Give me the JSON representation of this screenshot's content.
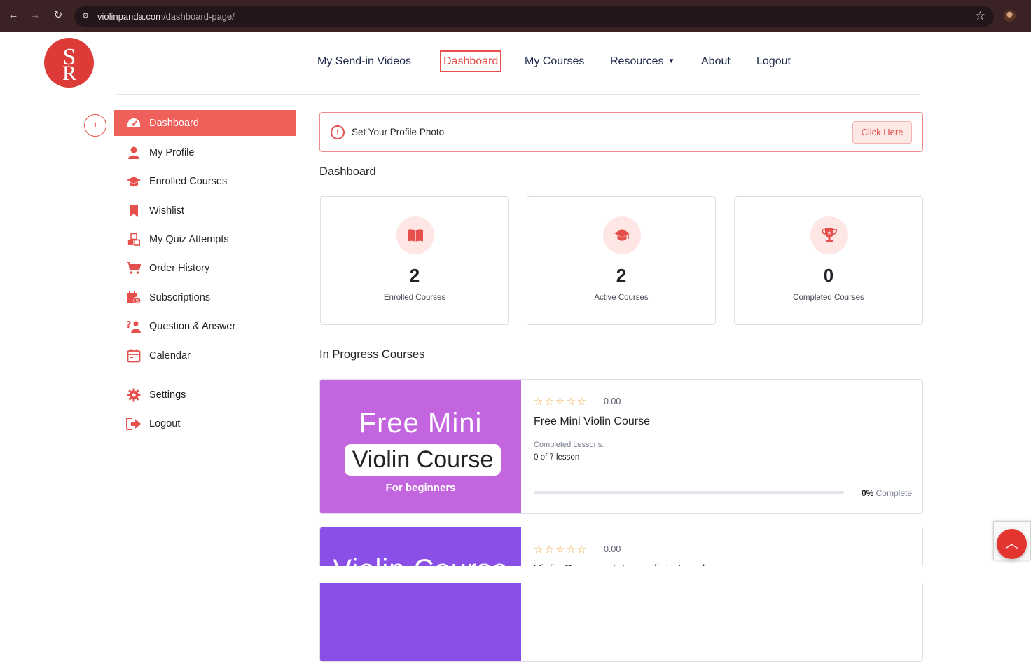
{
  "browser": {
    "url_host": "violinpanda.com",
    "url_path": "/dashboard-page/"
  },
  "topnav": {
    "items": [
      "My Send-in Videos",
      "Dashboard",
      "My Courses",
      "Resources",
      "About",
      "Logout"
    ],
    "active": "Dashboard"
  },
  "sidebar": {
    "step": "1",
    "items": [
      {
        "label": "Dashboard",
        "icon": "dashboard-icon"
      },
      {
        "label": "My Profile",
        "icon": "user-icon"
      },
      {
        "label": "Enrolled Courses",
        "icon": "graduation-cap-icon"
      },
      {
        "label": "Wishlist",
        "icon": "bookmark-icon"
      },
      {
        "label": "My Quiz Attempts",
        "icon": "quiz-blocks-icon"
      },
      {
        "label": "Order History",
        "icon": "cart-icon"
      },
      {
        "label": "Subscriptions",
        "icon": "calendar-dollar-icon"
      },
      {
        "label": "Question & Answer",
        "icon": "question-person-icon"
      },
      {
        "label": "Calendar",
        "icon": "calendar-icon"
      }
    ],
    "bottom_items": [
      {
        "label": "Settings",
        "icon": "gear-icon"
      },
      {
        "label": "Logout",
        "icon": "logout-icon"
      }
    ]
  },
  "alert": {
    "message": "Set Your Profile Photo",
    "button": "Click Here"
  },
  "dashboard": {
    "title": "Dashboard",
    "stats": [
      {
        "value": "2",
        "label": "Enrolled Courses",
        "icon": "book-open-icon"
      },
      {
        "value": "2",
        "label": "Active Courses",
        "icon": "graduation-cap-icon"
      },
      {
        "value": "0",
        "label": "Completed Courses",
        "icon": "trophy-icon"
      }
    ]
  },
  "in_progress": {
    "title": "In Progress Courses",
    "courses": [
      {
        "thumb_line1": "Free Mini",
        "thumb_line2": "Violin Course",
        "thumb_line3": "For beginners",
        "thumb_color": "#c465e0",
        "stars": "☆☆☆☆☆",
        "rating": "0.00",
        "title": "Free Mini Violin Course",
        "completed_label": "Completed Lessons:",
        "completed_value": "0 of 7 lesson",
        "progress_pct": "0%",
        "progress_fraction": 0,
        "progress_suffix": "Complete"
      },
      {
        "thumb_line1": "Violin Course",
        "thumb_color": "#8a4fe6",
        "stars": "☆☆☆☆☆",
        "rating": "0.00",
        "title": "Violin Course – Intermediate Level"
      }
    ]
  },
  "colors": {
    "accent": "#e5504c",
    "accent_light": "#fde6e4",
    "chrome": "#3b2225"
  }
}
